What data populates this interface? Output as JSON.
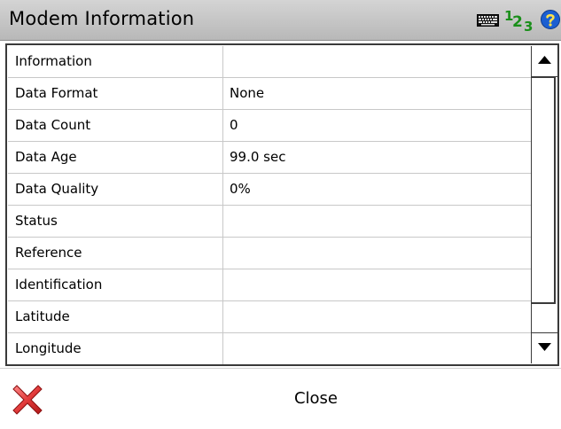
{
  "window": {
    "title": "Modem Information",
    "input_mode_digits": [
      "1",
      "2",
      "3"
    ]
  },
  "icons": {
    "keyboard": "keyboard-icon",
    "input_mode": "input-mode-123-icon",
    "help": "help-icon",
    "close": "close-x-icon",
    "scroll_up": "scroll-up-arrow-icon",
    "scroll_down": "scroll-down-arrow-icon"
  },
  "grid": {
    "rows": [
      {
        "label": "Information",
        "value": ""
      },
      {
        "label": "Data Format",
        "value": "None"
      },
      {
        "label": "Data Count",
        "value": "0"
      },
      {
        "label": "Data Age",
        "value": "99.0 sec"
      },
      {
        "label": "Data Quality",
        "value": "0%"
      },
      {
        "label": "Status",
        "value": ""
      },
      {
        "label": "Reference",
        "value": ""
      },
      {
        "label": "Identification",
        "value": ""
      },
      {
        "label": "Latitude",
        "value": ""
      },
      {
        "label": "Longitude",
        "value": ""
      }
    ]
  },
  "footer": {
    "close_label": "Close"
  },
  "colors": {
    "titlebar": "#c6c6c6",
    "help_blue": "#1b5fd1",
    "input_mode_green": "#1a8f1a",
    "close_red": "#e23b3b"
  }
}
